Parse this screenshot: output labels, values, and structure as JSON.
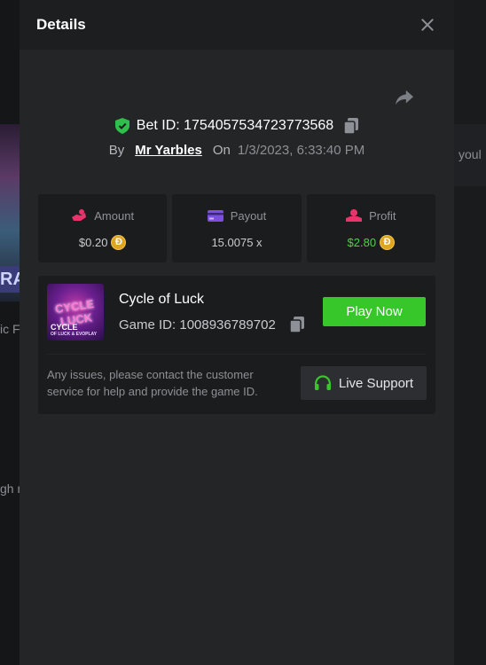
{
  "modal": {
    "title": "Details"
  },
  "bet": {
    "id_text": "Bet ID: 1754057534723773568",
    "by_label": "By",
    "user": "Mr Yarbles",
    "on_label": "On",
    "date": "1/3/2023, 6:33:40 PM"
  },
  "stats": {
    "amount": {
      "label": "Amount",
      "value": "$0.20",
      "icon": "amount-hand-icon",
      "icon_color": "#e8336b"
    },
    "payout": {
      "label": "Payout",
      "value": "15.0075 x",
      "icon": "card-icon",
      "icon_color": "#7b4fe0"
    },
    "profit": {
      "label": "Profit",
      "value": "$2.80",
      "icon": "profit-hand-icon",
      "icon_color": "#e8336b",
      "value_color": "#4fd14a"
    },
    "coin_symbol": "Đ"
  },
  "game": {
    "name": "Cycle of Luck",
    "id_text": "Game ID: 1008936789702",
    "play_label": "Play Now",
    "thumb_title": "CYCLE LUCK",
    "thumb_sub": "CYCLE",
    "thumb_caption": "OF LUCK & EVOPLAY"
  },
  "support": {
    "text": "Any issues, please contact the customer service for help and provide the game ID.",
    "button_label": "Live Support",
    "icon": "headset-icon"
  },
  "background": {
    "left_strip_text": "RAI",
    "left_text_1": "ic F",
    "left_text_2": "gh r",
    "right_text": "youl"
  },
  "colors": {
    "accent_green": "#37c72a",
    "shield_green": "#2ec04a",
    "modal_bg": "#242527"
  }
}
